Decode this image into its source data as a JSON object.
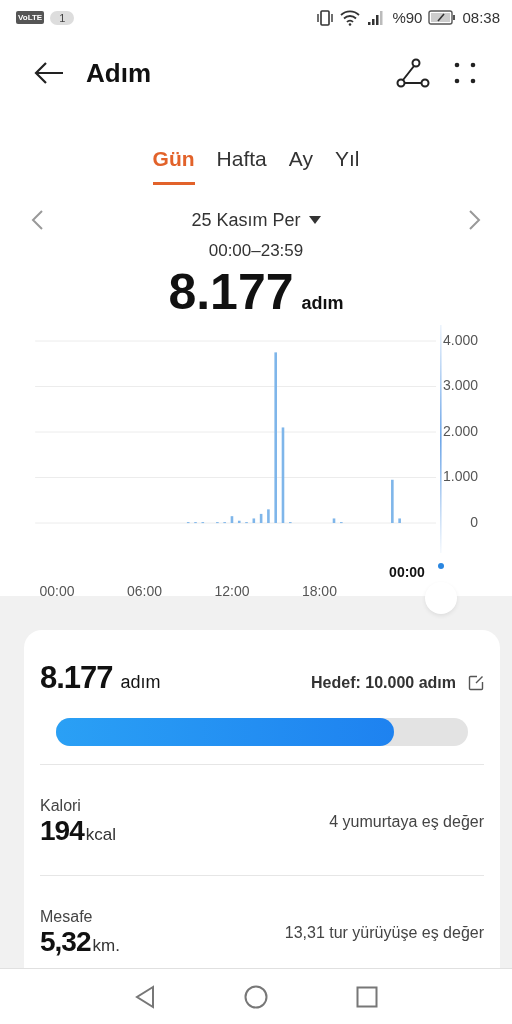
{
  "status_bar": {
    "network": "VoLTE",
    "sim": "1",
    "battery_percent": "%90",
    "time": "08:38"
  },
  "header": {
    "title": "Adım"
  },
  "tabs": [
    {
      "label": "Gün",
      "selected": true
    },
    {
      "label": "Hafta",
      "selected": false
    },
    {
      "label": "Ay",
      "selected": false
    },
    {
      "label": "Yıl",
      "selected": false
    }
  ],
  "date_nav": {
    "date": "25 Kasım Per",
    "range": "00:00–23:59",
    "total": "8.177",
    "unit": "adım"
  },
  "chart": {
    "cursor_label": "00:00",
    "chart_data": {
      "type": "bar",
      "x": [
        9,
        9.5,
        10,
        11,
        11.5,
        12,
        12.5,
        13,
        13.5,
        14,
        14.5,
        15,
        15.5,
        16,
        19,
        19.5,
        23,
        23.5
      ],
      "series": [
        {
          "color": "#7fb6ea",
          "values": [
            20,
            20,
            20,
            20,
            20,
            150,
            50,
            20,
            100,
            200,
            300,
            3750,
            2100,
            20,
            100,
            20,
            950,
            100
          ]
        }
      ],
      "xlim": [
        -1.5,
        26
      ],
      "ylim": [
        0,
        4000
      ],
      "grid": true,
      "xticks": [
        {
          "value": 0,
          "label": "00:00"
        },
        {
          "value": 6,
          "label": "06:00"
        },
        {
          "value": 12,
          "label": "12:00"
        },
        {
          "value": 18,
          "label": "18:00"
        }
      ],
      "yticks": [
        {
          "value": 0,
          "label": "0"
        },
        {
          "value": 1000,
          "label": "1.000"
        },
        {
          "value": 2000,
          "label": "2.000"
        },
        {
          "value": 3000,
          "label": "3.000"
        },
        {
          "value": 4000,
          "label": "4.000"
        }
      ]
    }
  },
  "summary": {
    "steps": "8.177",
    "unit": "adım",
    "goal": "Hedef: 10.000 adım",
    "level": 0.82
  },
  "metrics": [
    {
      "label": "Kalori",
      "value": "194",
      "unit": "kcal",
      "note": "4 yumurtaya eş değer"
    },
    {
      "label": "Mesafe",
      "value": "5,32",
      "unit": "km.",
      "note": "13,31 tur yürüyüşe eş değer"
    }
  ]
}
